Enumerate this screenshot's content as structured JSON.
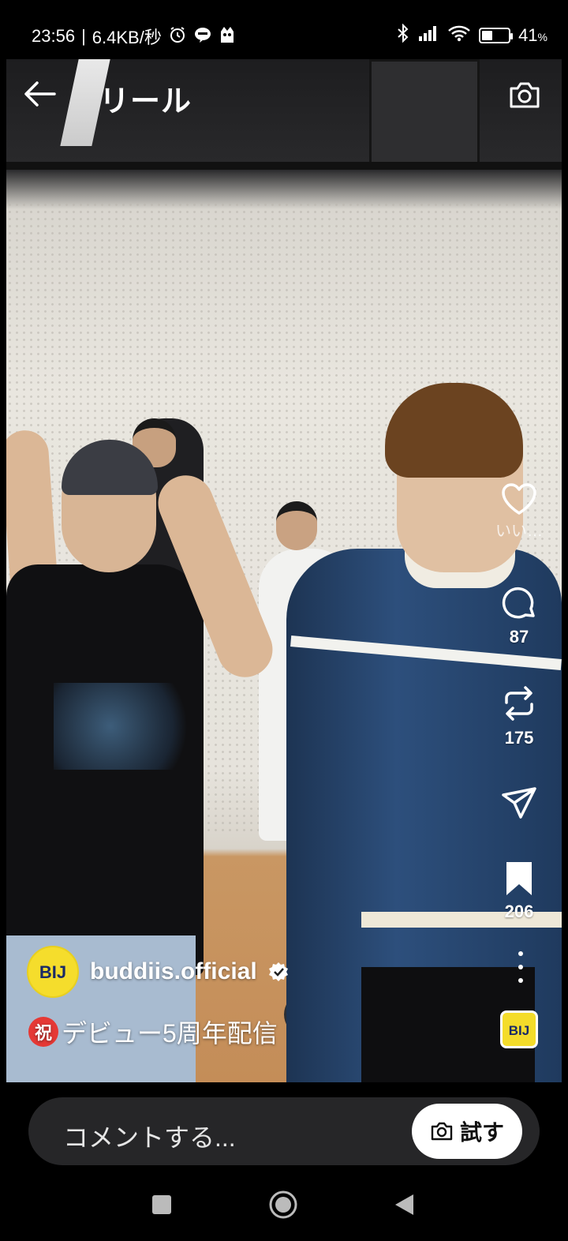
{
  "status_bar": {
    "time": "23:56",
    "separator": "|",
    "network_speed": "6.4KB/秒",
    "icons": [
      "alarm-icon",
      "line-app-icon",
      "notification-app-icon",
      "bluetooth-icon",
      "signal-icon",
      "wifi-icon",
      "battery-icon"
    ],
    "battery_percent": "41",
    "battery_unit": "%",
    "battery_level": 0.41
  },
  "header": {
    "back_icon": "arrow-left-icon",
    "title": "リール",
    "camera_icon": "camera-icon"
  },
  "rail": {
    "like_icon": "heart-icon",
    "like_label": "いい…",
    "comment_icon": "comment-bubble-icon",
    "comment_count": "87",
    "repost_icon": "repost-icon",
    "repost_count": "175",
    "share_icon": "send-icon",
    "save_icon": "bookmark-icon",
    "save_count": "206",
    "more_icon": "more-vertical-icon"
  },
  "reel": {
    "owner_name": "buddiis.official",
    "avatar_text": "BIJ",
    "verified_icon": "verified-badge-icon",
    "caption_emoji": "祝",
    "caption_text": "デビュー5周年配信",
    "audio_thumb_text": "BIJ"
  },
  "comment_bar": {
    "placeholder": "コメントする...",
    "try_label": "試す",
    "try_icon": "camera-icon"
  },
  "nav_bar": {
    "icons": [
      "recents-square-icon",
      "home-circle-icon",
      "back-triangle-icon"
    ]
  },
  "colors": {
    "brand_yellow": "#f5dd2c",
    "background": "#000000",
    "comment_box": "#262628"
  }
}
